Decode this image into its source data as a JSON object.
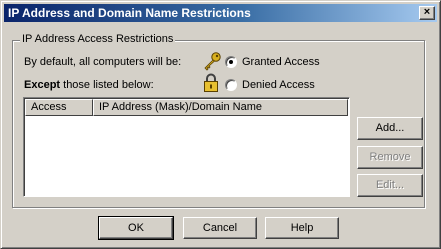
{
  "window": {
    "title": "IP Address and Domain Name Restrictions",
    "close_glyph": "×"
  },
  "group": {
    "legend": "IP Address Access Restrictions",
    "default_text": "By default, all computers will be:",
    "except_bold": "Except",
    "except_rest": " those listed below:",
    "options": [
      {
        "label": "Granted Access",
        "selected": true,
        "icon": "key-icon"
      },
      {
        "label": "Denied Access",
        "selected": false,
        "icon": "padlock-icon"
      }
    ]
  },
  "list": {
    "columns": [
      "Access",
      "IP Address (Mask)/Domain Name"
    ],
    "rows": []
  },
  "side_buttons": [
    {
      "label": "Add...",
      "enabled": true
    },
    {
      "label": "Remove",
      "enabled": false
    },
    {
      "label": "Edit...",
      "enabled": false
    }
  ],
  "footer_buttons": [
    "OK",
    "Cancel",
    "Help"
  ],
  "colors": {
    "title_start": "#0a246a",
    "title_end": "#a6caf0",
    "face": "#d4d0c8",
    "key_gold": "#d8b020",
    "lock_gold": "#e8c030"
  }
}
